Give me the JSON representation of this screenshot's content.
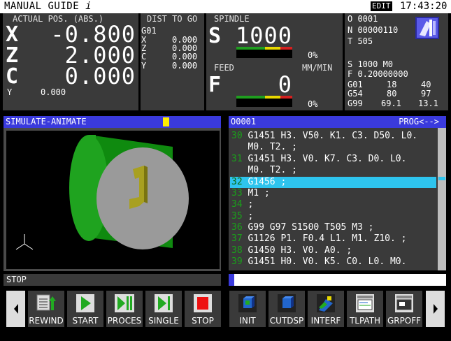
{
  "window": {
    "title": "MANUAL GUIDE",
    "title_suffix": "i",
    "edit_badge": "EDIT",
    "clock": "17:43:20"
  },
  "position": {
    "header": "ACTUAL POS. (ABS.)",
    "axes": [
      {
        "name": "X",
        "value": "-0.800"
      },
      {
        "name": "Z",
        "value": "2.000"
      },
      {
        "name": "C",
        "value": "0.000"
      }
    ],
    "y_label": "Y",
    "y_value": "0.000"
  },
  "dist_to_go": {
    "header": "DIST TO GO",
    "mode": "G01",
    "rows": [
      {
        "axis": "X",
        "value": "0.000"
      },
      {
        "axis": "Z",
        "value": "0.000"
      },
      {
        "axis": "C",
        "value": "0.000"
      },
      {
        "axis": "Y",
        "value": "0.000"
      }
    ]
  },
  "spindle": {
    "header": "SPINDLE",
    "letter": "S",
    "value": "1000",
    "override": "0%"
  },
  "feed": {
    "header": "FEED",
    "unit": "MM/MIN",
    "letter": "F",
    "value": "0",
    "override": "0%"
  },
  "program_info": {
    "o": "O 0001",
    "n": "N 00000110",
    "t": "T 505",
    "s_line": "S    1000 M0",
    "f_line": "F 0.20000000",
    "g_rows": [
      [
        "G01",
        "18",
        "40"
      ],
      [
        "G54",
        "80",
        "97"
      ],
      [
        "G99",
        "69.1",
        "13.1"
      ]
    ]
  },
  "simulate": {
    "title": "SIMULATE-ANIMATE",
    "status": "STOP"
  },
  "program": {
    "name": "O0001",
    "mode": "PROG<-->",
    "lines": [
      {
        "num": "30",
        "text": "G1451 H3. V50. K1. C3. D50. L0."
      },
      {
        "num": "",
        "text": "  M0. T2. ;"
      },
      {
        "num": "31",
        "text": "G1451 H3. V0. K7. C3. D0. L0."
      },
      {
        "num": "",
        "text": "  M0. T2. ;"
      },
      {
        "num": "32",
        "text": "G1456 ;"
      },
      {
        "num": "33",
        "text": "M1 ;"
      },
      {
        "num": "34",
        "text": ";"
      },
      {
        "num": "35",
        "text": ";"
      },
      {
        "num": "36",
        "text": "G99 G97 S1500 T505 M3 ;"
      },
      {
        "num": "37",
        "text": "G1126 P1. F0.4 L1. M1. Z10. ;"
      },
      {
        "num": "38",
        "text": "G1450 H3. V0. A0. ;"
      },
      {
        "num": "39",
        "text": "G1451 H0. V0. K5. C0. L0. M0."
      }
    ],
    "selected_line": 4
  },
  "softkeys_left": [
    "REWIND",
    "START",
    "PROCES",
    "SINGLE",
    "STOP"
  ],
  "softkeys_right": [
    "INIT",
    "CUTDSP",
    "INTERF",
    "TLPATH",
    "GRPOFF"
  ],
  "colors": {
    "accent_blue": "#3a3add",
    "highlight_cyan": "#2ec4ee",
    "line_num_green": "#1aa01a",
    "panel_gray": "#3a3a3a",
    "stop_red": "#ee1111",
    "play_green": "#22aa22"
  }
}
